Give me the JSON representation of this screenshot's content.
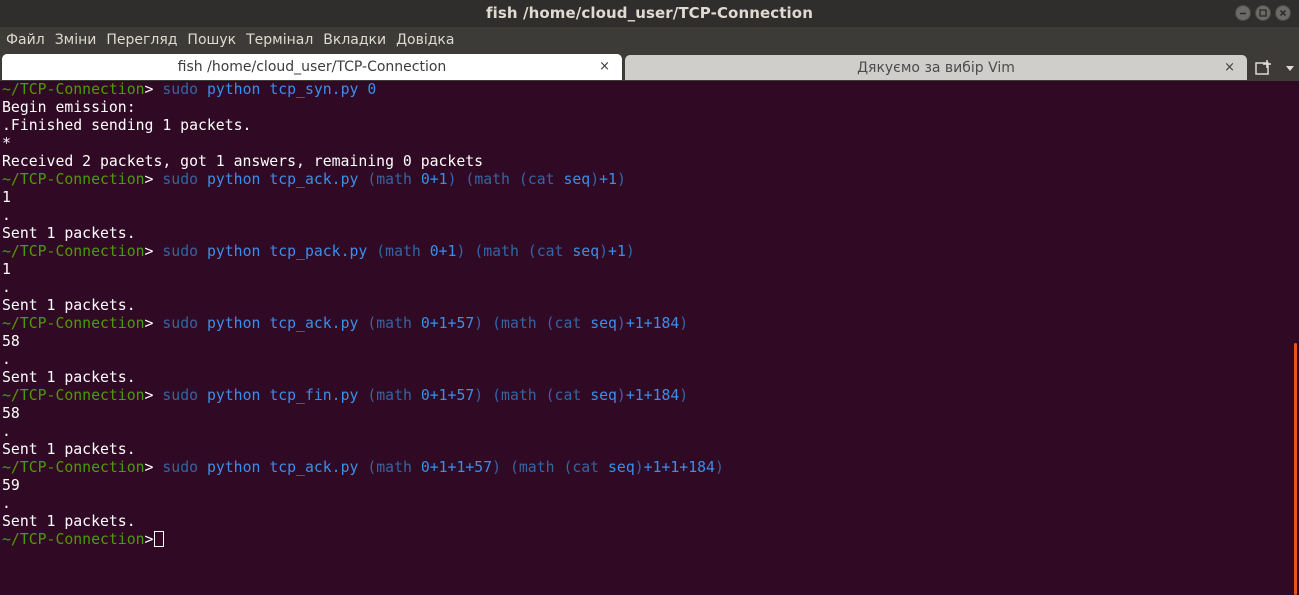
{
  "window": {
    "title": "fish  /home/cloud_user/TCP-Connection",
    "controls": [
      "minimize-icon",
      "maximize-icon",
      "close-icon"
    ]
  },
  "menu": {
    "items": [
      "Файл",
      "Зміни",
      "Перегляд",
      "Пошук",
      "Термінал",
      "Вкладки",
      "Довідка"
    ]
  },
  "tabs": [
    {
      "label": "fish  /home/cloud_user/TCP-Connection",
      "close": "×",
      "active": true
    },
    {
      "label": "Дякуємо за вибір Vim",
      "close": "×",
      "active": false
    }
  ],
  "tabbar_icons": [
    "new-tab-icon",
    "tab-menu-icon"
  ],
  "terminal": {
    "lines": [
      {
        "type": "prompt",
        "dir": "~/TCP-Connection",
        "gt": ">",
        "cmd": "sudo python tcp_syn.py 0"
      },
      {
        "type": "out",
        "text": "Begin emission:"
      },
      {
        "type": "out",
        "text": ".Finished sending 1 packets."
      },
      {
        "type": "out",
        "text": "*"
      },
      {
        "type": "out",
        "text": "Received 2 packets, got 1 answers, remaining 0 packets"
      },
      {
        "type": "prompt",
        "dir": "~/TCP-Connection",
        "gt": ">",
        "cmd": "sudo python tcp_ack.py (math 0+1) (math (cat seq)+1)"
      },
      {
        "type": "out",
        "text": "1"
      },
      {
        "type": "out",
        "text": "."
      },
      {
        "type": "out",
        "text": "Sent 1 packets."
      },
      {
        "type": "prompt",
        "dir": "~/TCP-Connection",
        "gt": ">",
        "cmd": "sudo python tcp_pack.py (math 0+1) (math (cat seq)+1)"
      },
      {
        "type": "out",
        "text": "1"
      },
      {
        "type": "out",
        "text": "."
      },
      {
        "type": "out",
        "text": "Sent 1 packets."
      },
      {
        "type": "prompt",
        "dir": "~/TCP-Connection",
        "gt": ">",
        "cmd": "sudo python tcp_ack.py (math 0+1+57) (math (cat seq)+1+184)"
      },
      {
        "type": "out",
        "text": "58"
      },
      {
        "type": "out",
        "text": "."
      },
      {
        "type": "out",
        "text": "Sent 1 packets."
      },
      {
        "type": "prompt",
        "dir": "~/TCP-Connection",
        "gt": ">",
        "cmd": "sudo python tcp_fin.py (math 0+1+57) (math (cat seq)+1+184)"
      },
      {
        "type": "out",
        "text": "58"
      },
      {
        "type": "out",
        "text": "."
      },
      {
        "type": "out",
        "text": "Sent 1 packets."
      },
      {
        "type": "prompt",
        "dir": "~/TCP-Connection",
        "gt": ">",
        "cmd": "sudo python tcp_ack.py (math 0+1+1+57) (math (cat seq)+1+1+184)"
      },
      {
        "type": "out",
        "text": "59"
      },
      {
        "type": "out",
        "text": "."
      },
      {
        "type": "out",
        "text": "Sent 1 packets."
      },
      {
        "type": "prompt",
        "dir": "~/TCP-Connection",
        "gt": ">",
        "cmd": "",
        "cursor": true
      }
    ]
  },
  "colors": {
    "terminal_bg": "#300a24",
    "prompt": "#4e9a06",
    "command": "#3b8eea",
    "text": "#ffffff",
    "scroll_thumb": "#e95420"
  }
}
